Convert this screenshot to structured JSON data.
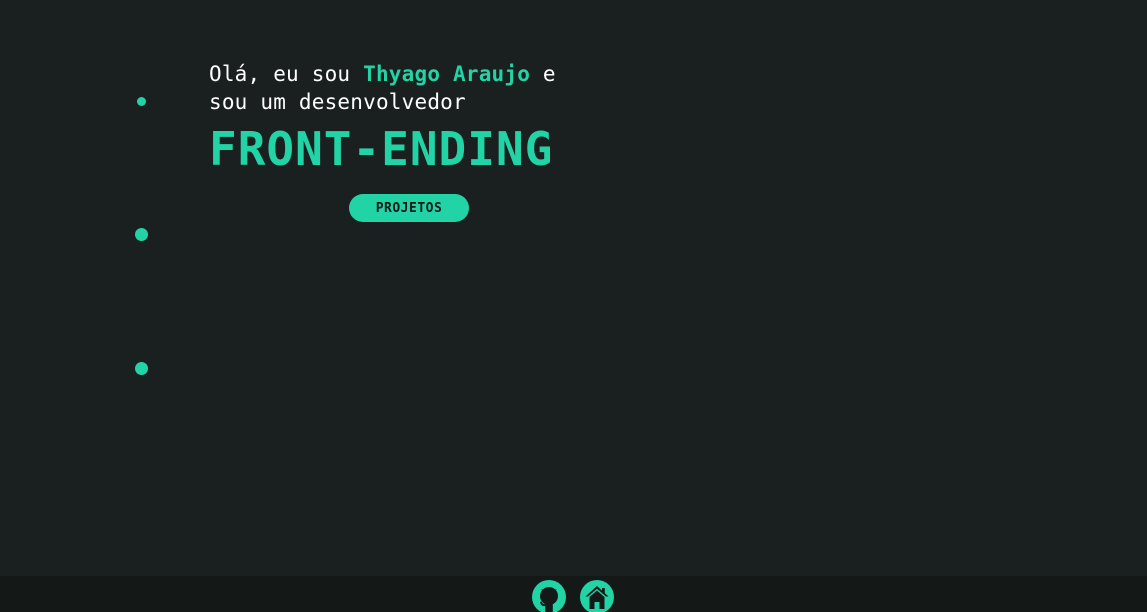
{
  "hero": {
    "intro_prefix": "Olá, eu sou ",
    "name": "Thyago Araujo",
    "intro_suffix": " e",
    "intro_line2": "sou um desenvolvedor",
    "headline": "FRONT-ENDING",
    "projects_button": "PROJETOS"
  },
  "footer": {
    "icons": [
      "github-icon",
      "home-icon"
    ]
  },
  "colors": {
    "background": "#1a2020",
    "accent": "#22d3a5",
    "footer": "#141918"
  }
}
